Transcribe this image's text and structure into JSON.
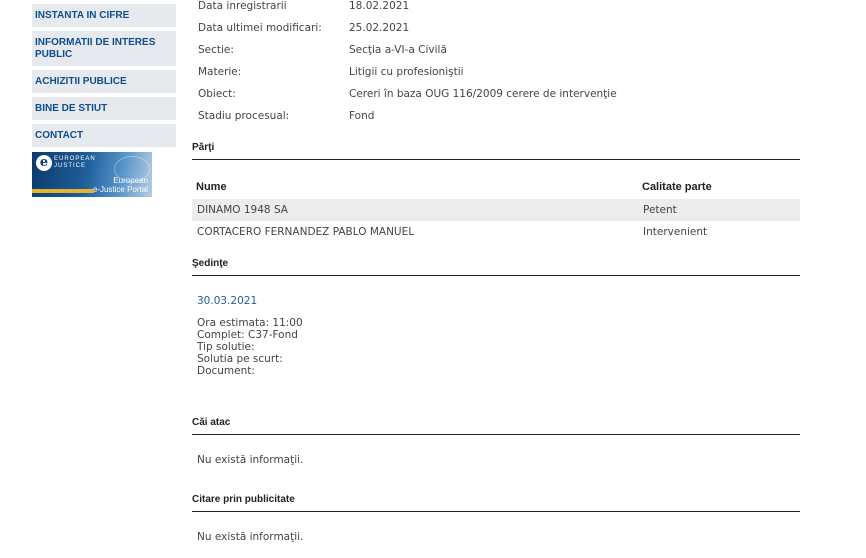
{
  "sidebar": {
    "items": [
      {
        "label": "INSTANTA IN CIFRE"
      },
      {
        "label_line1": "INFORMATII DE INTERES",
        "label_line2": "PUBLIC"
      },
      {
        "label": "ACHIZITII PUBLICE"
      },
      {
        "label": "BINE DE STIUT"
      },
      {
        "label": "CONTACT"
      }
    ],
    "banner": {
      "logo_letter": "e",
      "small_line1": "EUROPEAN",
      "small_line2": "JUSTICE",
      "title_line1": "European",
      "title_line2": "e-Justice Portal"
    }
  },
  "case_info": [
    {
      "label": "Data inregistrarii",
      "value": "18.02.2021"
    },
    {
      "label": "Data ultimei modificari:",
      "value": "25.02.2021"
    },
    {
      "label": "Sectie:",
      "value": "Secţia a-VI-a Civilă"
    },
    {
      "label": "Materie:",
      "value": "Litigii cu profesioniştii"
    },
    {
      "label": "Obiect:",
      "value": "Cereri în baza OUG 116/2009 cerere de intervenţie"
    },
    {
      "label": "Stadiu procesual:",
      "value": "Fond"
    }
  ],
  "parti": {
    "title": "Părţi",
    "headers": {
      "name": "Nume",
      "role": "Calitate parte"
    },
    "rows": [
      {
        "name": "DINAMO 1948 SA",
        "role": "Petent"
      },
      {
        "name": "CORTACERO FERNANDEZ PABLO MANUEL",
        "role": "Intervenient"
      }
    ]
  },
  "sedinte": {
    "title": "Şedinţe",
    "date": "30.03.2021",
    "lines": [
      "Ora estimata: 11:00",
      "Complet: C37-Fond",
      "Tip solutie:",
      "Solutia pe scurt:",
      "Document:"
    ]
  },
  "cai_atac": {
    "title": "Căi atac",
    "message": "Nu există informaţii."
  },
  "citare": {
    "title": "Citare prin publicitate",
    "message": "Nu există informaţii."
  }
}
